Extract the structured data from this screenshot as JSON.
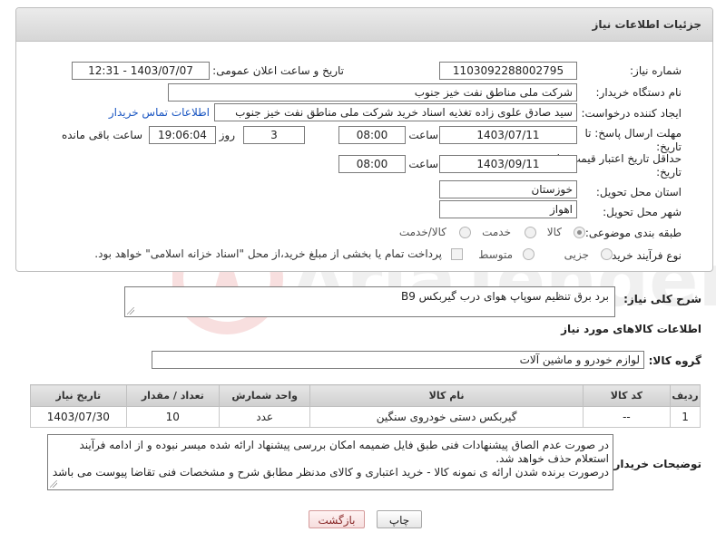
{
  "panel": {
    "title": "جزئیات اطلاعات نیاز"
  },
  "fields": {
    "need_number_label": "شماره نیاز:",
    "need_number": "1103092288002795",
    "announce_label": "تاریخ و ساعت اعلان عمومی:",
    "announce_value": "1403/07/07 - 12:31",
    "buyer_label": "نام دستگاه خریدار:",
    "buyer_value": "شرکت ملی مناطق نفت خیز جنوب",
    "creator_label": "ایجاد کننده درخواست:",
    "creator_value": "سید صادق علوی زاده  تغذیه اسناد خرید  شرکت ملی مناطق نفت خیز جنوب",
    "contact_link": "اطلاعات تماس خریدار",
    "deadline_label_1": "مهلت ارسال پاسخ: تا",
    "deadline_label_2": "تاریخ:",
    "deadline_date": "1403/07/11",
    "time_label": "ساعت",
    "deadline_time": "08:00",
    "days_value": "3",
    "days_label": "روز و",
    "remaining_value": "19:06:04",
    "remaining_label": "ساعت باقی مانده",
    "validity_label_1": "حداقل تاریخ اعتبار قیمت: تا",
    "validity_label_2": "تاریخ:",
    "validity_date": "1403/09/11",
    "validity_time": "08:00",
    "province_label": "استان محل تحویل:",
    "province_value": "خوزستان",
    "city_label": "شهر محل تحویل:",
    "city_value": "اهواز",
    "category_label": "طبقه بندی موضوعی:",
    "category_options": [
      "کالا",
      "خدمت",
      "کالا/خدمت"
    ],
    "process_label": "نوع فرآیند خرید :",
    "process_options": [
      "جزیی",
      "متوسط"
    ],
    "payment_note": "پرداخت تمام یا بخشی از مبلغ خرید،از محل \"اسناد خزانه اسلامی\" خواهد بود."
  },
  "summary": {
    "label": "شرح کلی نیاز:",
    "value": "برد برق تنظیم سوپاپ هوای درب گیربکس B9"
  },
  "goods": {
    "section_title": "اطلاعات کالاهای مورد نیاز",
    "group_label": "گروه کالا:",
    "group_value": "لوازم خودرو و ماشین آلات",
    "headers": [
      "ردیف",
      "کد کالا",
      "نام کالا",
      "واحد شمارش",
      "تعداد / مقدار",
      "تاریخ نیاز"
    ],
    "rows": [
      [
        "1",
        "--",
        "گیربکس دستی خودروی سنگین",
        "عدد",
        "10",
        "1403/07/30"
      ]
    ]
  },
  "buyer_notes": {
    "label": "توضیحات خریدار:",
    "lines": [
      "در صورت عدم الصاق پیشنهادات فنی طبق فایل ضمیمه امکان بررسی پیشنهاد ارائه شده میسر نبوده و از ادامه فرآیند",
      "استعلام حذف خواهد شد.",
      "درصورت برنده شدن ارائه ی نمونه کالا - خرید اعتباری و کالای مدنظر مطابق شرح و مشخصات فنی تقاضا پیوست می باشد"
    ]
  },
  "buttons": {
    "print": "چاپ",
    "back": "بازگشت"
  },
  "colors": {
    "link": "#1a56c2",
    "header_bg": "#d6d6d6"
  }
}
